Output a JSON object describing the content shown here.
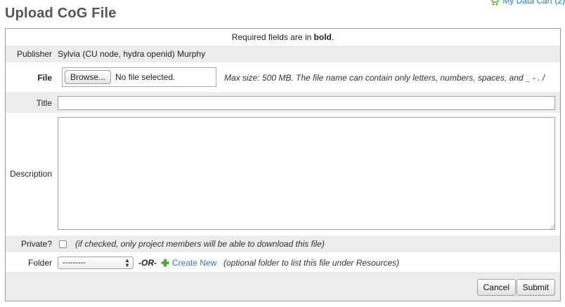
{
  "header": {
    "title": "Upload CoG File",
    "cart_label": "My Data Cart (2)"
  },
  "form": {
    "required_note_prefix": "Required fields are in ",
    "required_note_bold": "bold",
    "required_note_suffix": ".",
    "publisher": {
      "label": "Publisher",
      "value": "Sylvia (CU node, hydra openid) Murphy"
    },
    "file": {
      "label": "File",
      "browse_label": "Browse...",
      "status": "No file selected.",
      "hint": "Max size: 500 MB. The file name can contain only letters, numbers, spaces, and _ - . /"
    },
    "title_field": {
      "label": "Title",
      "value": ""
    },
    "description": {
      "label": "Description",
      "value": ""
    },
    "private": {
      "label": "Private?",
      "checked": false,
      "hint": "(if checked, only project members will be able to download this file)"
    },
    "folder": {
      "label": "Folder",
      "selected": "---------",
      "or_text": "-OR-",
      "create_label": "Create New",
      "hint": "(optional folder to list this file under Resources)"
    },
    "buttons": {
      "cancel": "Cancel",
      "submit": "Submit"
    }
  },
  "colors": {
    "link": "#2a7ab0",
    "shaded_row": "#ececec",
    "title": "#555555",
    "plus_icon": "#4caf2f"
  },
  "icons": {
    "cart": "shopping-cart-icon",
    "plus": "plus-icon"
  }
}
